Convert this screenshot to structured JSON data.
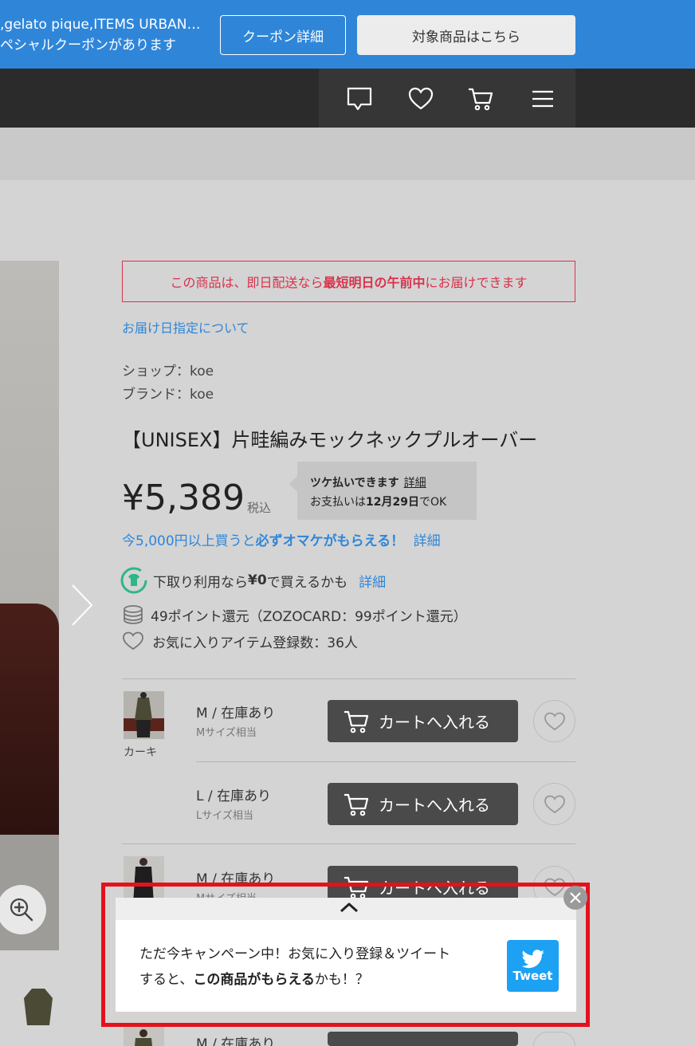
{
  "banner": {
    "line1": ",gelato pique,ITEMS URBAN…",
    "line2": "ペシャルクーポンがあります",
    "coupon_button": "クーポン詳細",
    "target_button": "対象商品はこちら"
  },
  "nav": {
    "icons": [
      "chat-icon",
      "heart-icon",
      "cart-icon",
      "menu-icon"
    ]
  },
  "delivery": {
    "prefix": "この商品は、即日配送なら",
    "highlight": "最短明日の午前中",
    "suffix": "にお届けできます",
    "link": "お届け日指定について"
  },
  "product": {
    "shop": "ショップ：koe",
    "brand": "ブランド：koe",
    "title": "【UNISEX】片畦編みモックネックプルオーバー",
    "price": "¥5,389",
    "tax": "税込"
  },
  "tsuke": {
    "label": "ツケ払いできます",
    "detail": "詳細",
    "pay_prefix": "お支払いは",
    "pay_date": "12月29日",
    "pay_suffix": "でOK"
  },
  "omake": {
    "prefix": "今5,000円以上買うと",
    "highlight": "必ずオマケがもらえる！",
    "detail": "詳細"
  },
  "tradein": {
    "prefix": "下取り利用なら",
    "highlight": "¥0",
    "suffix": "で買えるかも",
    "detail": "詳細"
  },
  "points": "49ポイント還元（ZOZOCARD：99ポイント還元）",
  "favorites": "お気に入りアイテム登録数：36人",
  "variants": [
    {
      "color": "カーキ",
      "size": "M / 在庫あり",
      "sub": "Mサイズ相当",
      "cart": "カートへ入れる"
    },
    {
      "size": "L / 在庫あり",
      "sub": "Lサイズ相当",
      "cart": "カートへ入れる"
    },
    {
      "size": "M / 在庫あり",
      "sub": "Mサイズ相当",
      "cart": "カートへ入れる"
    },
    {
      "size": "M / 在庫あり"
    }
  ],
  "popup": {
    "line1": "ただ今キャンペーン中！お気に入り登録＆ツイート",
    "line2_prefix": "すると、",
    "line2_bold": "この商品がもらえる",
    "line2_suffix": "かも！？",
    "tweet": "Tweet"
  },
  "colors": {
    "banner": "#2f86d9",
    "nav": "#2b2b2b",
    "alert": "#d8324b",
    "highlight_frame": "#e4121b",
    "twitter": "#1da1f2"
  }
}
